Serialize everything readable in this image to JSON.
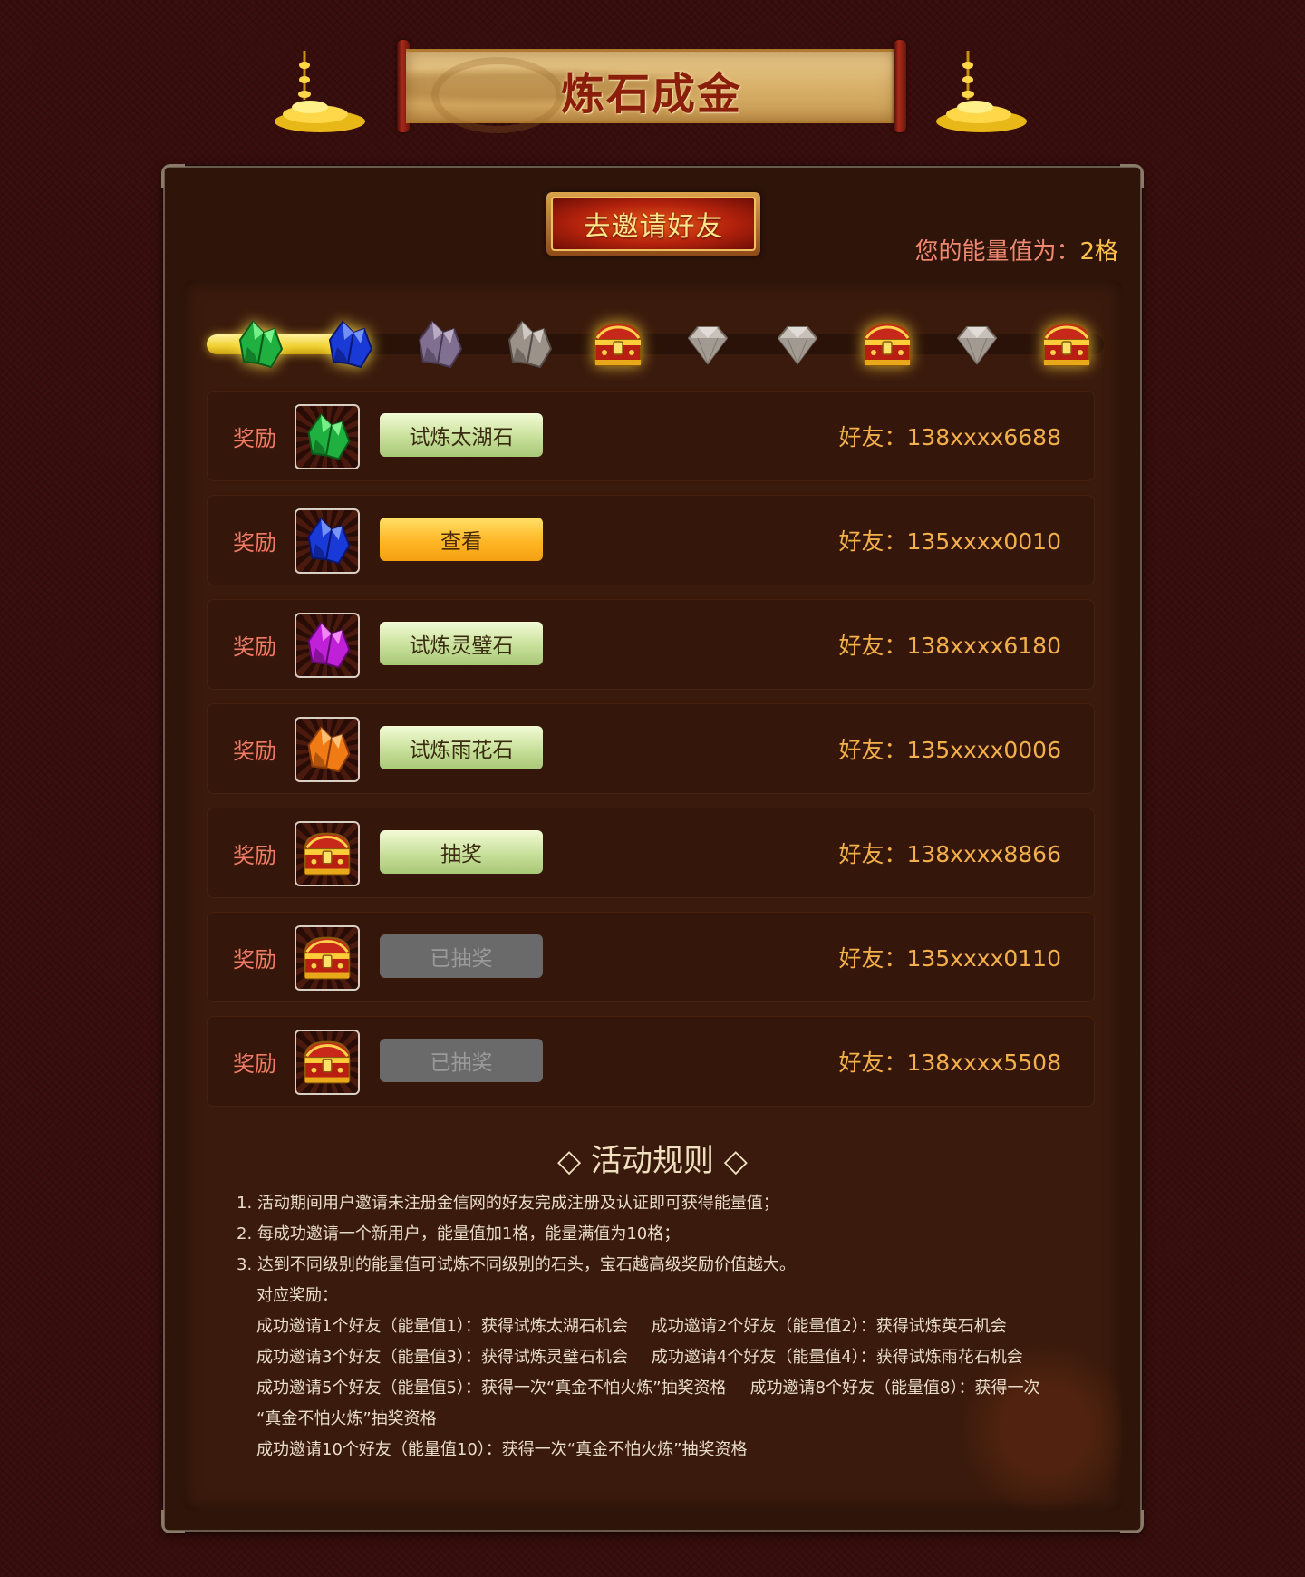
{
  "banner": {
    "title": "炼石成金"
  },
  "header": {
    "invite_label": "去邀请好友",
    "energy_prefix": "您的能量值为：",
    "energy_value": "2格"
  },
  "progress": {
    "level": 2,
    "max": 10,
    "steps": [
      "green-crystal",
      "blue-crystal",
      "purple-crystal",
      "gray-crystal",
      "treasure-chest",
      "diamond",
      "diamond",
      "treasure-chest",
      "diamond",
      "treasure-chest"
    ]
  },
  "rewards": [
    {
      "label": "奖励",
      "icon": "green-crystal",
      "button": "试炼太湖石",
      "state": "green",
      "friend": "好友：138xxxx6688"
    },
    {
      "label": "奖励",
      "icon": "blue-crystal",
      "button": "查看",
      "state": "gold",
      "friend": "好友：135xxxx0010"
    },
    {
      "label": "奖励",
      "icon": "purple-crystal",
      "button": "试炼灵璧石",
      "state": "green",
      "friend": "好友：138xxxx6180"
    },
    {
      "label": "奖励",
      "icon": "orange-crystal",
      "button": "试炼雨花石",
      "state": "green",
      "friend": "好友：135xxxx0006"
    },
    {
      "label": "奖励",
      "icon": "treasure-chest",
      "button": "抽奖",
      "state": "green",
      "friend": "好友：138xxxx8866"
    },
    {
      "label": "奖励",
      "icon": "treasure-chest",
      "button": "已抽奖",
      "state": "gray",
      "friend": "好友：135xxxx0110"
    },
    {
      "label": "奖励",
      "icon": "treasure-chest",
      "button": "已抽奖",
      "state": "gray",
      "friend": "好友：138xxxx5508"
    }
  ],
  "rules": {
    "title": "◇ 活动规则 ◇",
    "line1": "1. 活动期间用户邀请未注册金信网的好友完成注册及认证即可获得能量值；",
    "line2": "2. 每成功邀请一个新用户，能量值加1格，能量满值为10格；",
    "line3": "3. 达到不同级别的能量值可试炼不同级别的石头，宝石越高级奖励价值越大。",
    "sub_title": "对应奖励：",
    "r1a": "成功邀请1个好友（能量值1）：获得试炼太湖石机会",
    "r1b": "成功邀请2个好友（能量值2）：获得试炼英石机会",
    "r2a": "成功邀请3个好友（能量值3）：获得试炼灵璧石机会",
    "r2b": "成功邀请4个好友（能量值4）：获得试炼雨花石机会",
    "r3a": "成功邀请5个好友（能量值5）：获得一次“真金不怕火炼”抽奖资格",
    "r3b": "成功邀请8个好友（能量值8）：获得一次",
    "r3c": "“真金不怕火炼”抽奖资格",
    "r4": "成功邀请10个好友（能量值10）：获得一次“真金不怕火炼”抽奖资格"
  },
  "colors": {
    "background": "#3a0f0d",
    "panel": "#2e1409",
    "accent_gold": "#f3b04a",
    "label_red": "#f07a64"
  }
}
